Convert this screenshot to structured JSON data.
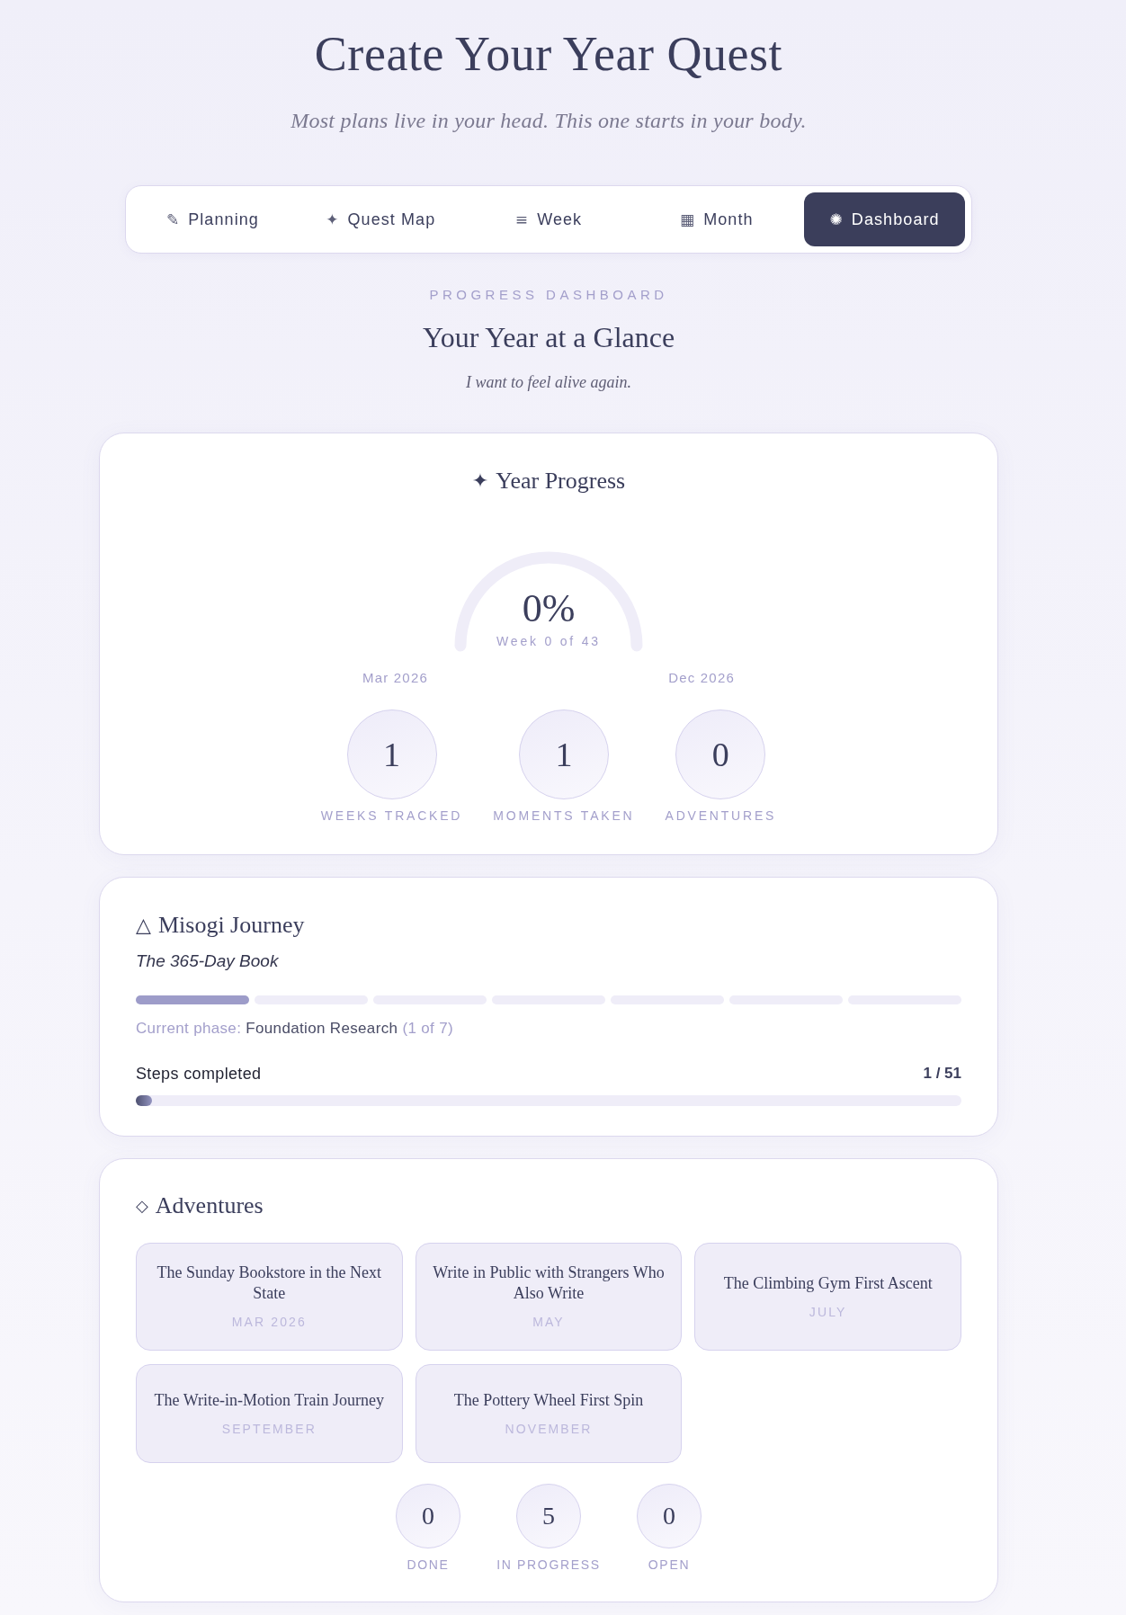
{
  "header": {
    "title": "Create Your Year Quest",
    "subtitle": "Most plans live in your head. This one starts in your body."
  },
  "tabs": [
    {
      "icon": "✎",
      "label": "Planning",
      "selected": false
    },
    {
      "icon": "✦",
      "label": "Quest Map",
      "selected": false
    },
    {
      "icon": "≡",
      "label": "Week",
      "selected": false
    },
    {
      "icon": "▦",
      "label": "Month",
      "selected": false
    },
    {
      "icon": "✺",
      "label": "Dashboard",
      "selected": true
    }
  ],
  "dashboard": {
    "eyebrow": "PROGRESS DASHBOARD",
    "title": "Your Year at a Glance",
    "intention": "I want to feel alive again."
  },
  "year_progress": {
    "icon": "✦",
    "title": "Year Progress",
    "gauge": {
      "percent": "0%",
      "caption": "Week 0 of 43"
    },
    "start_label": "Mar 2026",
    "end_label": "Dec 2026",
    "stats": [
      {
        "value": "1",
        "label": "WEEKS TRACKED"
      },
      {
        "value": "1",
        "label": "MOMENTS TAKEN"
      },
      {
        "value": "0",
        "label": "ADVENTURES"
      }
    ]
  },
  "journey": {
    "icon": "△",
    "title": "Misogi Journey",
    "subtitle": "The 365-Day Book",
    "phase_segments": [
      {
        "filled": true
      },
      {
        "filled": false
      },
      {
        "filled": false
      },
      {
        "filled": false
      },
      {
        "filled": false
      },
      {
        "filled": false
      },
      {
        "filled": false
      }
    ],
    "phase_label": "Current phase:",
    "phase_name": "Foundation Research",
    "phase_count": "(1 of 7)",
    "steps_label": "Steps completed",
    "steps_count": "1 / 51",
    "steps": {
      "level": 0.0196
    }
  },
  "adventures": {
    "icon": "◇",
    "title": "Adventures",
    "items": [
      {
        "title": "The Sunday Bookstore in the Next State",
        "date": "MAR 2026"
      },
      {
        "title": "Write in Public with Strangers Who Also Write",
        "date": "MAY"
      },
      {
        "title": "The Climbing Gym First Ascent",
        "date": "JULY"
      },
      {
        "title": "The Write-in-Motion Train Journey",
        "date": "SEPTEMBER"
      },
      {
        "title": "The Pottery Wheel First Spin",
        "date": "NOVEMBER"
      }
    ],
    "stats": [
      {
        "value": "0",
        "label": "DONE"
      },
      {
        "value": "5",
        "label": "IN PROGRESS"
      },
      {
        "value": "0",
        "label": "OPEN"
      }
    ]
  }
}
